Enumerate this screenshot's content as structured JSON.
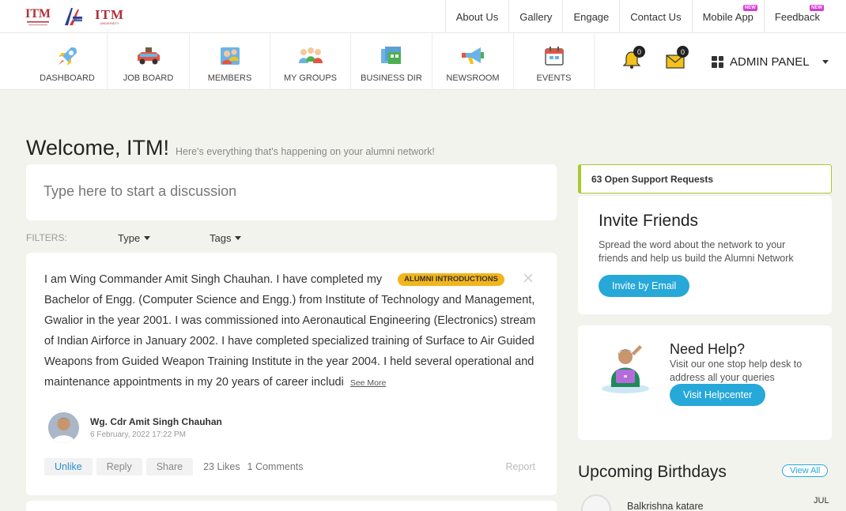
{
  "top_nav": {
    "logos": {
      "itm": "ITM",
      "itm_univ": "ITM",
      "itm_univ_sub": "UNIVERSITY"
    },
    "items": [
      {
        "label": "About Us"
      },
      {
        "label": "Gallery"
      },
      {
        "label": "Engage"
      },
      {
        "label": "Contact Us"
      },
      {
        "label": "Mobile App",
        "badge": "NEW"
      },
      {
        "label": "Feedback",
        "badge": "NEW"
      }
    ]
  },
  "main_nav": {
    "items": [
      {
        "label": "DASHBOARD",
        "icon": "rocket-icon"
      },
      {
        "label": "JOB BOARD",
        "icon": "car-icon"
      },
      {
        "label": "MEMBERS",
        "icon": "members-icon"
      },
      {
        "label": "MY GROUPS",
        "icon": "groups-icon"
      },
      {
        "label": "BUSINESS DIR",
        "icon": "business-icon"
      },
      {
        "label": "NEWSROOM",
        "icon": "megaphone-icon"
      },
      {
        "label": "EVENTS",
        "icon": "calendar-icon"
      }
    ],
    "notifications_count": "0",
    "messages_count": "0",
    "admin_label": "ADMIN PANEL"
  },
  "welcome": {
    "title": "Welcome, ITM!",
    "subtitle": "Here's everything that's happening on your alumni network!"
  },
  "compose": {
    "placeholder": "Type here to start a discussion"
  },
  "filters": {
    "label": "FILTERS:",
    "type": "Type",
    "tags": "Tags"
  },
  "post": {
    "text": "I am Wing Commander Amit Singh Chauhan. I have completed my",
    "tag": "ALUMNI INTRODUCTIONS",
    "text_cont": "Bachelor of Engg. (Computer Science and Engg.) from Institute of Technology and Management, Gwalior in the year 2001. I was commissioned into Aeronautical Engineering (Electronics) stream of Indian Airforce in January 2002. I have completed specialized training of Surface to Air Guided Weapons from Guided Weapon Training Institute in the year 2004. I held several operational and maintenance appointments in my 20 years of career includi",
    "see_more": "See More",
    "author": "Wg. Cdr Amit Singh Chauhan",
    "date": "6 February, 2022 17:22 PM",
    "unlike": "Unlike",
    "reply": "Reply",
    "share": "Share",
    "likes": "23 Likes",
    "comments": "1 Comments",
    "report": "Report"
  },
  "support": {
    "label": "63 Open Support Requests"
  },
  "invite": {
    "title": "Invite Friends",
    "text": "Spread the word about the network to your friends and help us build the Alumni Network",
    "button": "Invite by Email"
  },
  "help": {
    "title": "Need Help?",
    "text": "Visit our one stop help desk to address all your queries",
    "button": "Visit Helpcenter"
  },
  "birthdays": {
    "title": "Upcoming Birthdays",
    "view_all": "View All",
    "items": [
      {
        "name": "Balkrishna katare",
        "month": "JUL"
      }
    ]
  },
  "colors": {
    "accent": "#26a8d8",
    "tag": "#f2b51b",
    "support_border": "#a8c92d"
  }
}
